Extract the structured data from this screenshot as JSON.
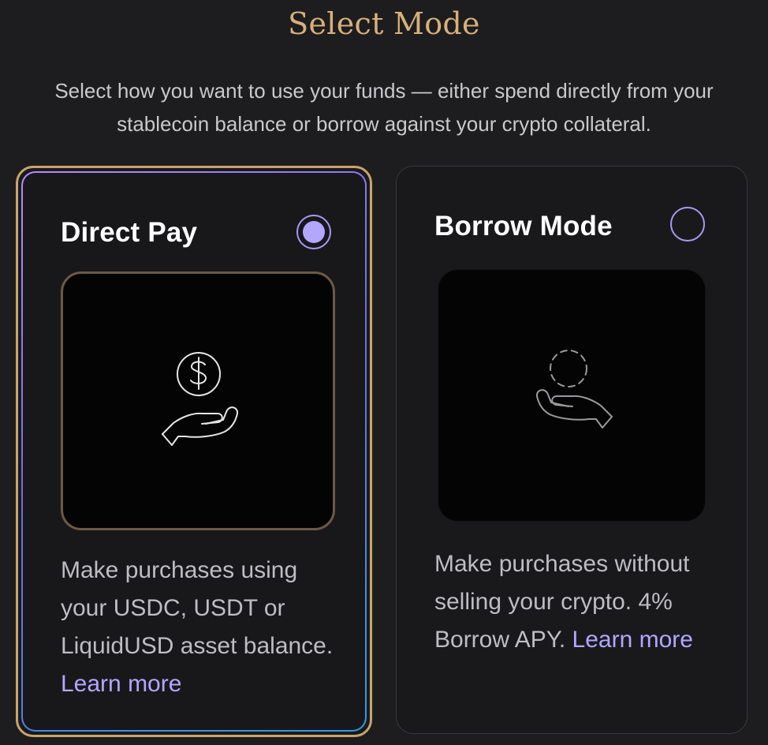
{
  "header": {
    "title": "Select Mode",
    "subtitle": "Select how you want to use your funds — either spend directly from your stablecoin balance or borrow against your crypto collateral."
  },
  "modes": [
    {
      "title": "Direct Pay",
      "selected": true,
      "icon": "hand-holding-dollar-icon",
      "description": "Make purchases using your USDC, USDT or LiquidUSD asset balance.",
      "link": "Learn more"
    },
    {
      "title": "Borrow Mode",
      "selected": false,
      "icon": "hand-holding-dashed-coin-icon",
      "description": "Make purchases without selling your crypto. 4% Borrow APY.",
      "link": "Learn more"
    }
  ],
  "colors": {
    "background": "#1d1d1f",
    "title": "#d8b07b",
    "accent": "#b3a6ff",
    "selected_border": "#c9a46a"
  }
}
